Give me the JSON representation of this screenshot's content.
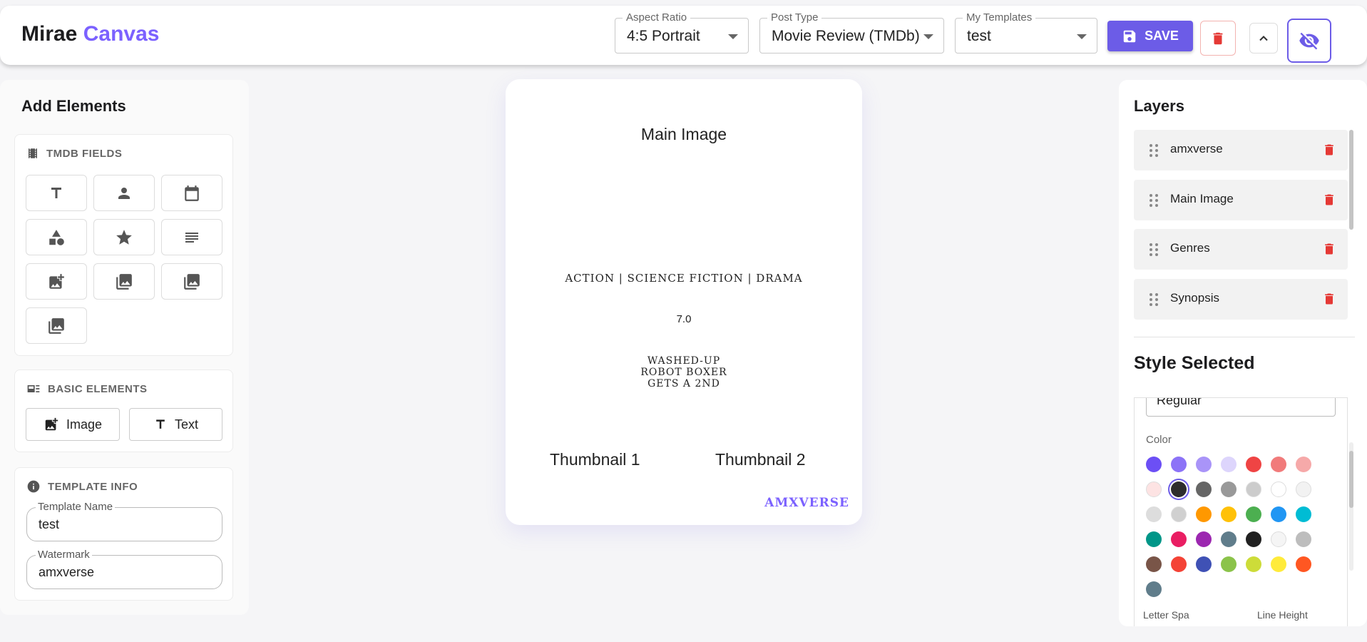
{
  "header": {
    "brand_main": "Mirae",
    "brand_accent": "Canvas",
    "aspect_ratio": {
      "label": "Aspect Ratio",
      "value": "4:5 Portrait"
    },
    "post_type": {
      "label": "Post Type",
      "value": "Movie Review (TMDb)"
    },
    "my_templates": {
      "label": "My Templates",
      "value": "test"
    },
    "save_label": "SAVE"
  },
  "left": {
    "title": "Add Elements",
    "tmdb_title": "TMDB FIELDS",
    "tmdb_buttons": [
      "text-field-icon",
      "person-icon",
      "calendar-icon",
      "shapes-icon",
      "star-icon",
      "paragraph-icon",
      "add-photo-icon",
      "photo-library-icon",
      "photo-library-icon",
      "photo-library-icon"
    ],
    "basic_title": "BASIC ELEMENTS",
    "basic_image": "Image",
    "basic_text": "Text",
    "info_title": "TEMPLATE INFO",
    "template_name_label": "Template Name",
    "template_name_value": "test",
    "watermark_label": "Watermark",
    "watermark_value": "amxverse"
  },
  "canvas": {
    "main_image": "Main Image",
    "genres": "ACTION | SCIENCE FICTION | DRAMA",
    "rating": "7.0",
    "synopsis_1": "WASHED-UP",
    "synopsis_2": "ROBOT BOXER",
    "synopsis_3": "GETS A 2ND",
    "thumbnail_1": "Thumbnail 1",
    "thumbnail_2": "Thumbnail 2",
    "watermark": "AMXVERSE"
  },
  "right": {
    "layers_title": "Layers",
    "layers": [
      "amxverse",
      "Main Image",
      "Genres",
      "Synopsis"
    ],
    "style_title": "Style Selected",
    "font_weight_value": "Regular",
    "color_label": "Color",
    "letter_spacing_label": "Letter Spa",
    "line_height_label": "Line Height",
    "colors": [
      "#6c4ff5",
      "#8c73f7",
      "#a994f8",
      "#ddd5fc",
      "#ef4444",
      "#f17b7b",
      "#f6a9a9",
      "#fde3e3",
      "#2d2d2d",
      "#666666",
      "#999999",
      "#cccccc",
      "#ffffff",
      "#f2f2f2",
      "#dddddd",
      "#d0d0d0",
      "#ff9800",
      "#ffc107",
      "#4caf50",
      "#2196f3",
      "#00bcd4",
      "#009688",
      "#e91e63",
      "#9c27b0",
      "#607d8b",
      "#212121",
      "#f5f5f5",
      "#bdbdbd",
      "#795548",
      "#f44336",
      "#3f51b5",
      "#8bc34a",
      "#cddc39",
      "#ffeb3b",
      "#ff5722",
      "#607d8b"
    ]
  },
  "colors": {
    "accent": "#6c5ce7",
    "danger": "#e53935"
  }
}
